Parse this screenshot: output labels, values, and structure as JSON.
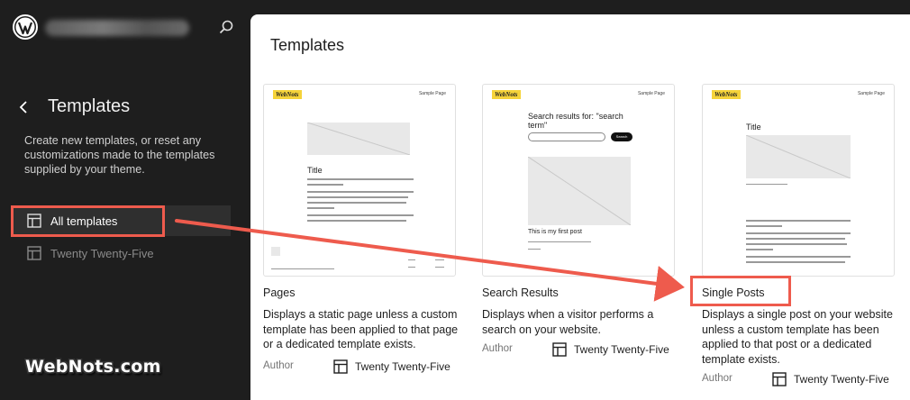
{
  "sidebar": {
    "title": "Templates",
    "description": "Create new templates, or reset any customizations made to the templates supplied by your theme.",
    "nav": [
      {
        "label": "All templates",
        "active": true
      },
      {
        "label": "Twenty Twenty-Five",
        "active": false
      }
    ],
    "brand": "WebNots.com"
  },
  "main": {
    "title": "Templates",
    "author_label": "Author",
    "cards": [
      {
        "title": "Pages",
        "description": "Displays a static page unless a custom template has been applied to that page or a dedicated template exists.",
        "author": "Twenty Twenty-Five",
        "preview": {
          "logo": "WebNots",
          "nav": "Sample Page",
          "heading": "Title"
        }
      },
      {
        "title": "Search Results",
        "description": "Displays when a visitor performs a search on your website.",
        "author": "Twenty Twenty-Five",
        "preview": {
          "logo": "WebNots",
          "nav": "Sample Page",
          "heading": "Search results for: \"search term\"",
          "post": "This is my first post",
          "search_button": "Search"
        }
      },
      {
        "title": "Single Posts",
        "description": "Displays a single post on your website unless a custom template has been applied to that post or a dedicated template exists.",
        "author": "Twenty Twenty-Five",
        "preview": {
          "logo": "WebNots",
          "nav": "Sample Page",
          "heading": "Title"
        }
      }
    ]
  },
  "colors": {
    "highlight": "#ee5b4d",
    "sidebar_bg": "#1e1e1e",
    "logo_yellow": "#f5d33a"
  },
  "icons": [
    "wordpress-logo-icon",
    "search-icon",
    "chevron-left-icon",
    "layout-icon"
  ]
}
